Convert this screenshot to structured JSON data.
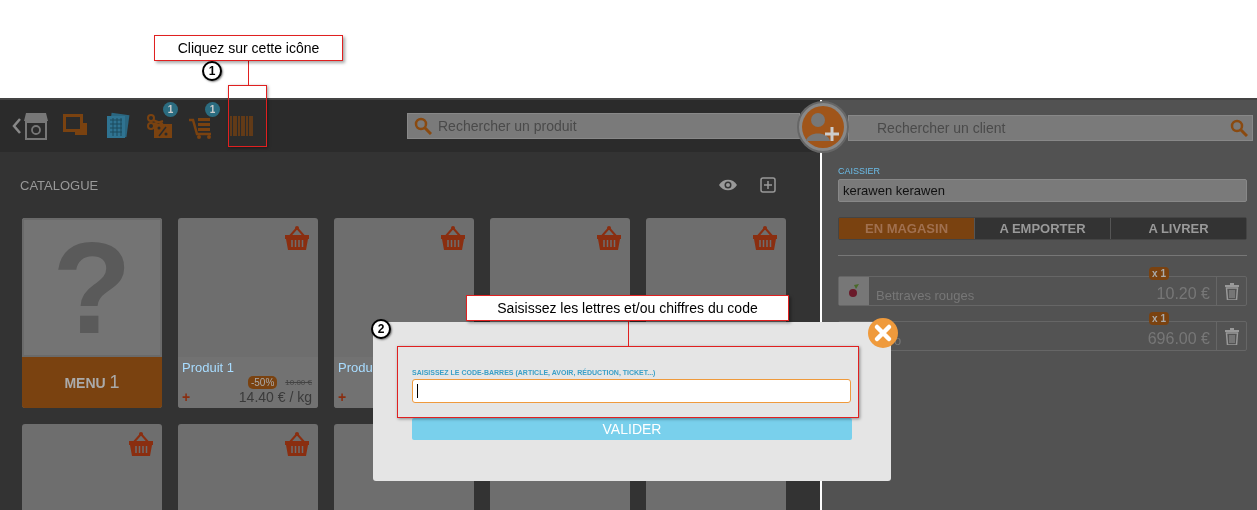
{
  "callouts": [
    {
      "number": "1",
      "text": "Cliquez sur cette icône"
    },
    {
      "number": "2",
      "text": "Saisissez les lettres et/ou chiffres du code"
    }
  ],
  "toolbar": {
    "items": [
      {
        "kind": "back-shop"
      },
      {
        "kind": "screen"
      },
      {
        "kind": "tablets"
      },
      {
        "kind": "discount",
        "badge": "1"
      },
      {
        "kind": "cart",
        "badge": "1"
      },
      {
        "kind": "barcode"
      }
    ]
  },
  "product_search": {
    "placeholder": "Rechercher un produit"
  },
  "catalogue": {
    "title": "CATALOGUE",
    "cards": [
      {
        "kind": "menu",
        "glyph": "?",
        "label": "MENU",
        "number": "1"
      },
      {
        "kind": "product",
        "basket": true,
        "name": "Produit 1",
        "discount": "-50%",
        "old_price": "10.00 €",
        "add": "+",
        "price": "14.40 € / kg"
      },
      {
        "kind": "product",
        "basket": true,
        "name": "Produ",
        "add": "+"
      },
      {
        "kind": "blank",
        "basket": true
      },
      {
        "kind": "blank",
        "basket": true
      },
      {
        "kind": "blank",
        "basket": true
      },
      {
        "kind": "blank",
        "basket": true
      },
      {
        "kind": "blank",
        "basket": false
      },
      {
        "kind": "blank",
        "basket": false
      },
      {
        "kind": "blank",
        "basket": false
      }
    ]
  },
  "client_search": {
    "placeholder": "Rechercher un client"
  },
  "cashier": {
    "label": "CAISSIER",
    "value": "kerawen kerawen"
  },
  "modes": [
    {
      "label": "EN MAGASIN",
      "selected": true
    },
    {
      "label": "A EMPORTER",
      "selected": false
    },
    {
      "label": "A LIVRER",
      "selected": false
    }
  ],
  "order_lines": [
    {
      "kind": "full",
      "name": "Bettraves rouges",
      "quantity": "x 1",
      "price": "10.20 €"
    },
    {
      "kind": "partial",
      "name": "o",
      "quantity": "x 1",
      "price": "696.00 €"
    }
  ],
  "barcode_dialog": {
    "label": "SAISISSEZ LE CODE-BARRES (ARTICLE, AVOIR, RÉDUCTION, TICKET...)",
    "button": "VALIDER"
  }
}
